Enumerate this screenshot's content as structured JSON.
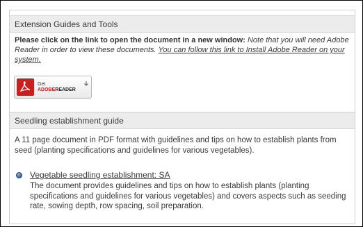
{
  "tools_section": {
    "header": "Extension Guides and Tools",
    "intro_bold": "Please click on the link to open the document in a new window:",
    "intro_italic": "Note that you will need Adobe Reader in order to view these documents.",
    "install_link": "You can follow this link to Install Adobe Reader on your system.",
    "badge": {
      "get": "Get",
      "brand_prefix": "ADOBE",
      "brand_suffix": "READER",
      "logo_icon": "adobe-reader-icon",
      "arrow_icon": "download-arrow-icon",
      "brand_color": "#c8201e"
    }
  },
  "seedling_section": {
    "header": "Seedling establishment guide",
    "description": "A 11 page document in PDF format with guidelines and tips on how to establish plants from seed (planting specifications and guidelines for various vegetables).",
    "documents": [
      {
        "bullet_icon": "bullet-icon",
        "title": "Vegetable seedling establishment: SA",
        "summary": "The document provides guidelines and tips on how to establish plants (planting specifications and guidelines for various vegetables) and covers aspects such as seeding rate, sowing depth, row spacing, soil preparation."
      }
    ]
  },
  "colors": {
    "header_bg": "#ececec",
    "text": "#3a3a3a",
    "bullet": "#2f5f9a"
  }
}
